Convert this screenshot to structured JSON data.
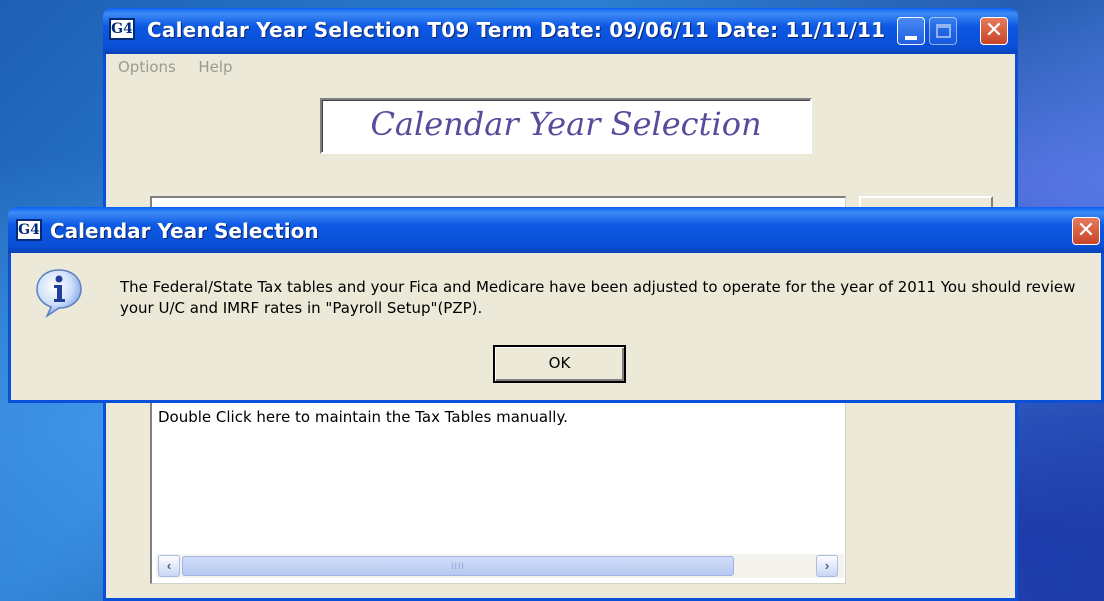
{
  "main_window": {
    "icon_text": "G4",
    "title": "Calendar Year Selection   T09  Term Date: 09/06/11  Date: 11/11/11",
    "menu": [
      "Options",
      "Help"
    ],
    "banner": "Calendar Year Selection",
    "list_row": "Double Click here to maintain the Tax Tables manually.",
    "scroll_grip": "IIII"
  },
  "dialog": {
    "icon_text": "G4",
    "title": "Calendar Year Selection",
    "message": "The Federal/State Tax tables and your Fica and Medicare have been adjusted to operate for the year of 2011  You should review your U/C and IMRF rates in \"Payroll Setup\"(PZP).",
    "ok_label": "OK"
  },
  "icons": {
    "minimize": "minimize-icon",
    "maximize": "maximize-icon",
    "close": "close-icon",
    "info": "info-icon",
    "scroll_left": "scroll-left-arrow-icon",
    "scroll_right": "scroll-right-arrow-icon"
  },
  "colors": {
    "titlebar": "#0a4fd8",
    "window_bg": "#ece9d8",
    "banner_text": "#5a4a9c",
    "close_button": "#c8452a"
  }
}
